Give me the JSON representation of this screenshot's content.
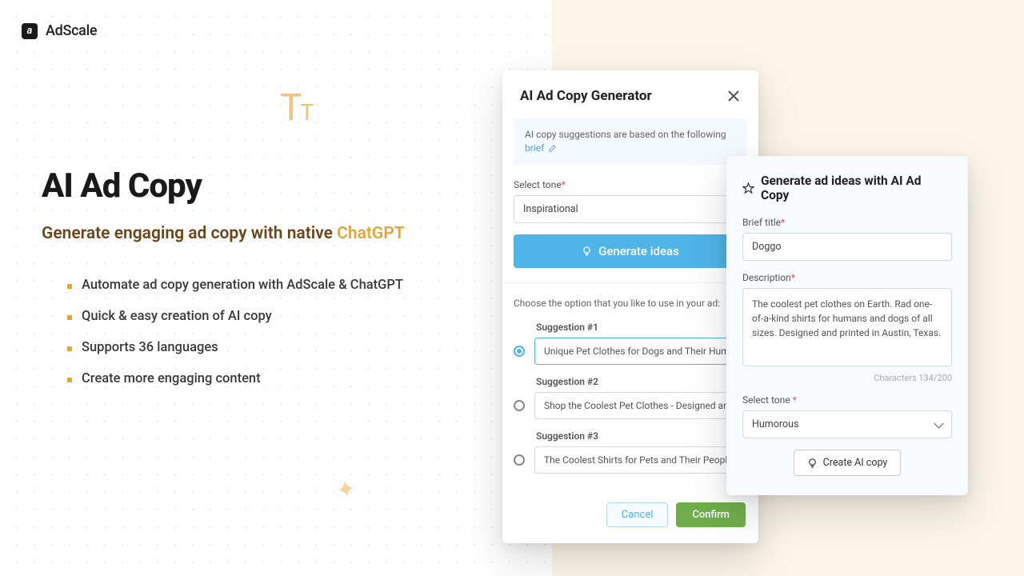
{
  "brand": {
    "name": "AdScale",
    "mark": "a"
  },
  "hero": {
    "title": "AI Ad Copy",
    "subtitle_prefix": "Generate engaging ad copy with native ",
    "subtitle_highlight": "ChatGPT",
    "bullets": [
      "Automate ad copy generation with AdScale & ChatGPT",
      "Quick & easy creation of AI copy",
      "Supports 36 languages",
      "Create more engaging content"
    ]
  },
  "generator": {
    "title": "AI Ad Copy Generator",
    "info_prefix": "AI copy suggestions are based on the following ",
    "info_link": "brief",
    "tone_label": "Select tone",
    "tone_value": "Inspirational",
    "generate_label": "Generate ideas",
    "choose_text": "Choose the option that you like to use in your ad:",
    "suggestions": [
      {
        "label": "Suggestion #1",
        "text": "Unique Pet Clothes for Dogs and Their Humans",
        "selected": true
      },
      {
        "label": "Suggestion #2",
        "text": "Shop the Coolest Pet Clothes - Designed and Printed",
        "selected": false
      },
      {
        "label": "Suggestion #3",
        "text": "The Coolest Shirts for Pets and Their People - Buy",
        "selected": false
      }
    ],
    "cancel": "Cancel",
    "confirm": "Confirm"
  },
  "brief_panel": {
    "title": "Generate ad ideas with AI Ad Copy",
    "title_label": "Brief title",
    "title_value": "Doggo",
    "desc_label": "Description",
    "desc_value": "The coolest pet clothes on Earth. Rad one-of-a-kind shirts for humans and dogs of all sizes. Designed and printed in Austin, Texas.",
    "char_count": "Characters 134/200",
    "tone_label": "Select tone ",
    "tone_value": "Humorous",
    "create_label": "Create AI copy"
  }
}
